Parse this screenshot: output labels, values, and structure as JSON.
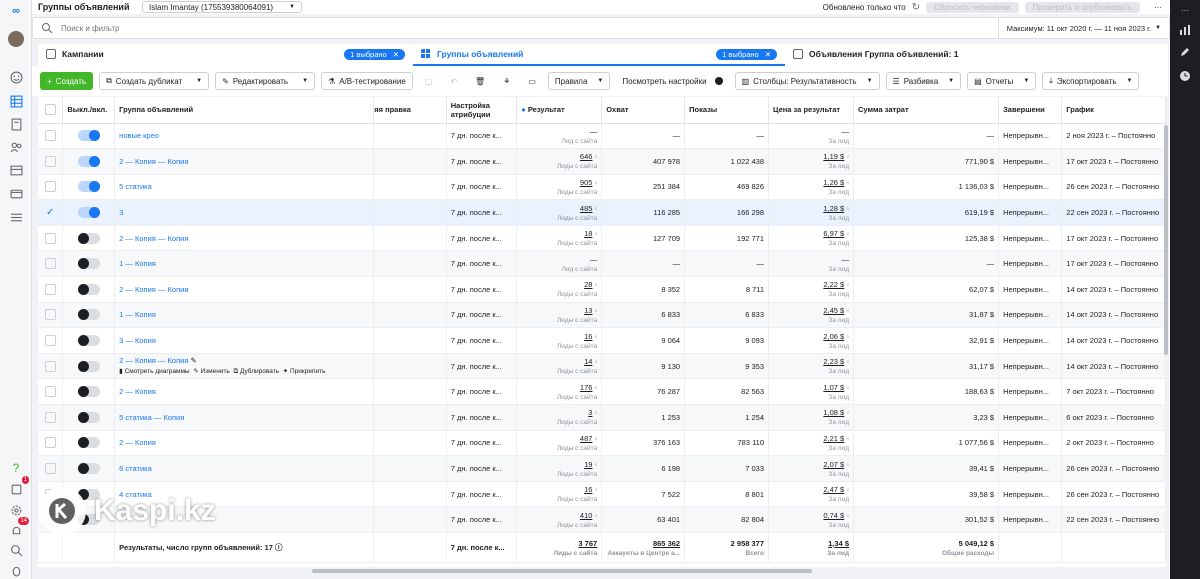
{
  "header": {
    "page_title": "Группы объявлений",
    "account": "Islam Imantay (175539380064091)",
    "status": "Обновлено только что",
    "discard_label": "Сбросить черновики",
    "publish_label": "Проверить и опубликовать"
  },
  "search": {
    "placeholder": "Поиск и фильтр",
    "date_range": "Максимум: 11 окт 2020 г. — 11 ноя 2023 г."
  },
  "tabs": {
    "campaigns": {
      "label": "Кампании",
      "selected": "1 выбрано"
    },
    "adsets": {
      "label": "Группы объявлений",
      "selected": "1 выбрано"
    },
    "ads": {
      "label": "Объявления Группа объявлений: 1"
    }
  },
  "toolbar": {
    "create": "Создать",
    "duplicate": "Создать дубликат",
    "edit": "Редактировать",
    "ab_test": "A/B-тестирование",
    "rules": "Правила",
    "view_settings": "Посмотреть настройки",
    "columns": "Столбцы: Результативность",
    "breakdown": "Разбивка",
    "reports": "Отчеты",
    "export": "Экспортировать"
  },
  "table": {
    "columns": {
      "toggle": "Выкл./вкл.",
      "name": "Группа объявлений",
      "last_edit": "яя правка",
      "attribution": "Настройка атрибуции",
      "result": "Результат",
      "reach": "Охват",
      "impressions": "Показы",
      "cost": "Цена за результат",
      "spend": "Сумма затрат",
      "end": "Завершени",
      "schedule": "График"
    },
    "rows": [
      {
        "on": true,
        "checked": false,
        "name": "новые крео",
        "attr": "7 дн. после к...",
        "result": "—",
        "result_sub": "Лид с сайта",
        "reach": "—",
        "impr": "—",
        "cost": "—",
        "cost_sub": "За лид",
        "spend": "—",
        "end": "Непрерывн...",
        "schedule": "2 ноя 2023 г. – Постоянно"
      },
      {
        "on": true,
        "checked": false,
        "name": "2 — Копия — Копия",
        "attr": "7 дн. после к...",
        "result": "646",
        "result_sub": "Лиды с сайта",
        "reach": "407 978",
        "impr": "1 022 438",
        "cost": "1,19 $",
        "cost_sub": "За лид",
        "spend": "771,90 $",
        "end": "Непрерывн...",
        "schedule": "17 окт 2023 г. – Постоянно"
      },
      {
        "on": true,
        "checked": false,
        "name": "5 статика",
        "attr": "7 дн. после к...",
        "result": "905",
        "result_sub": "Лиды с сайта",
        "reach": "251 384",
        "impr": "469 826",
        "cost": "1,26 $",
        "cost_sub": "За лид",
        "spend": "1 136,03 $",
        "end": "Непрерывн...",
        "schedule": "26 сен 2023 г. – Постоянно"
      },
      {
        "on": true,
        "checked": true,
        "name": "3",
        "attr": "7 дн. после к...",
        "result": "485",
        "result_sub": "Лиды с сайта",
        "reach": "116 285",
        "impr": "166 298",
        "cost": "1,28 $",
        "cost_sub": "За лид",
        "spend": "619,19 $",
        "end": "Непрерывн...",
        "schedule": "22 сен 2023 г. – Постоянно"
      },
      {
        "on": false,
        "checked": false,
        "name": "2 — Копия — Копия",
        "attr": "7 дн. после к...",
        "result": "18",
        "result_sub": "Лиды с сайта",
        "reach": "127 709",
        "impr": "192 771",
        "cost": "6,97 $",
        "cost_sub": "За лид",
        "spend": "125,38 $",
        "end": "Непрерывн...",
        "schedule": "17 окт 2023 г. – Постоянно"
      },
      {
        "on": false,
        "checked": false,
        "name": "1 — Копия",
        "attr": "7 дн. после к...",
        "result": "—",
        "result_sub": "Лид с сайта",
        "reach": "—",
        "impr": "—",
        "cost": "—",
        "cost_sub": "За лид",
        "spend": "—",
        "end": "Непрерывн...",
        "schedule": "17 окт 2023 г. – Постоянно"
      },
      {
        "on": false,
        "checked": false,
        "name": "2 — Копия — Копия",
        "attr": "7 дн. после к...",
        "result": "28",
        "result_sub": "Лиды с сайта",
        "reach": "8 352",
        "impr": "8 711",
        "cost": "2,22 $",
        "cost_sub": "За лид",
        "spend": "62,07 $",
        "end": "Непрерывн...",
        "schedule": "14 окт 2023 г. – Постоянно"
      },
      {
        "on": false,
        "checked": false,
        "name": "1 — Копия",
        "attr": "7 дн. после к...",
        "result": "13",
        "result_sub": "Лиды с сайта",
        "reach": "6 833",
        "impr": "6 833",
        "cost": "2,45 $",
        "cost_sub": "За лид",
        "spend": "31,87 $",
        "end": "Непрерывн...",
        "schedule": "14 окт 2023 г. – Постоянно"
      },
      {
        "on": false,
        "checked": false,
        "name": "3 — Копия",
        "attr": "7 дн. после к...",
        "result": "16",
        "result_sub": "Лиды с сайта",
        "reach": "9 064",
        "impr": "9 093",
        "cost": "2,06 $",
        "cost_sub": "За лид",
        "spend": "32,91 $",
        "end": "Непрерывн...",
        "schedule": "14 окт 2023 г. – Постоянно"
      },
      {
        "on": false,
        "checked": false,
        "name": "2 — Копия — Копия",
        "hover": true,
        "attr": "7 дн. после к...",
        "result": "14",
        "result_sub": "Лиды с сайта",
        "reach": "9 130",
        "impr": "9 353",
        "cost": "2,23 $",
        "cost_sub": "За лид",
        "spend": "31,17 $",
        "end": "Непрерывн...",
        "schedule": "14 окт 2023 г. – Постоянно"
      },
      {
        "on": false,
        "checked": false,
        "name": "2 — Копия",
        "attr": "7 дн. после к...",
        "result": "176",
        "result_sub": "Лиды с сайта",
        "reach": "76 287",
        "impr": "82 563",
        "cost": "1,07 $",
        "cost_sub": "За лид",
        "spend": "188,63 $",
        "end": "Непрерывн...",
        "schedule": "7 окт 2023 г. – Постоянно"
      },
      {
        "on": false,
        "checked": false,
        "name": "5 статика — Копия",
        "attr": "7 дн. после к...",
        "result": "3",
        "result_sub": "Лиды с сайта",
        "reach": "1 253",
        "impr": "1 254",
        "cost": "1,08 $",
        "cost_sub": "За лид",
        "spend": "3,23 $",
        "end": "Непрерывн...",
        "schedule": "6 окт 2023 г. – Постоянно"
      },
      {
        "on": false,
        "checked": false,
        "name": "2 — Копия",
        "attr": "7 дн. после к...",
        "result": "487",
        "result_sub": "Лиды с сайта",
        "reach": "376 163",
        "impr": "783 110",
        "cost": "2,21 $",
        "cost_sub": "За лид",
        "spend": "1 077,56 $",
        "end": "Непрерывн...",
        "schedule": "2 окт 2023 г. – Постоянно"
      },
      {
        "on": false,
        "checked": false,
        "name": "6 статика",
        "attr": "7 дн. после к...",
        "result": "19",
        "result_sub": "Лиды с сайта",
        "reach": "6 198",
        "impr": "7 033",
        "cost": "2,07 $",
        "cost_sub": "За лид",
        "spend": "39,41 $",
        "end": "Непрерывн...",
        "schedule": "26 сен 2023 г. – Постоянно"
      },
      {
        "on": false,
        "checked": false,
        "name": "4 статика",
        "attr": "7 дн. после к...",
        "result": "16",
        "result_sub": "Лиды с сайта",
        "reach": "7 522",
        "impr": "8 801",
        "cost": "2,47 $",
        "cost_sub": "За лид",
        "spend": "39,58 $",
        "end": "Непрерывн...",
        "schedule": "26 сен 2023 г. – Постоянно"
      },
      {
        "on": false,
        "checked": false,
        "name": "",
        "attr": "7 дн. после к...",
        "result": "410",
        "result_sub": "Лиды с сайта",
        "reach": "63 401",
        "impr": "82 804",
        "cost": "0,74 $",
        "cost_sub": "За лид",
        "spend": "301,52 $",
        "end": "Непрерывн...",
        "schedule": "22 сен 2023 г. – Постоянно"
      }
    ],
    "hover_actions": {
      "charts": "Смотреть диаграммы",
      "edit": "Изменить",
      "duplicate": "Дублировать",
      "pin": "Прикрепить"
    },
    "footer": {
      "label": "Результаты, число групп объявлений: 17",
      "attr": "7 дн. после к...",
      "result": "3 767",
      "result_sub": "Лиды с сайта",
      "reach": "865 362",
      "reach_sub": "Аккаунты в Центре а...",
      "impr": "2 958 377",
      "impr_sub": "Всего",
      "cost": "1,34 $",
      "cost_sub": "За лид",
      "spend": "5 049,12 $",
      "spend_sub": "Общие расходы"
    }
  },
  "left_rail": {
    "notif_badge": "1",
    "alerts_badge": "14"
  },
  "watermark": {
    "text": "Kaspi.kz"
  },
  "colors": {
    "accent": "#1877f2",
    "create_green": "#42b72a",
    "selected_row": "#eaf2fe"
  }
}
